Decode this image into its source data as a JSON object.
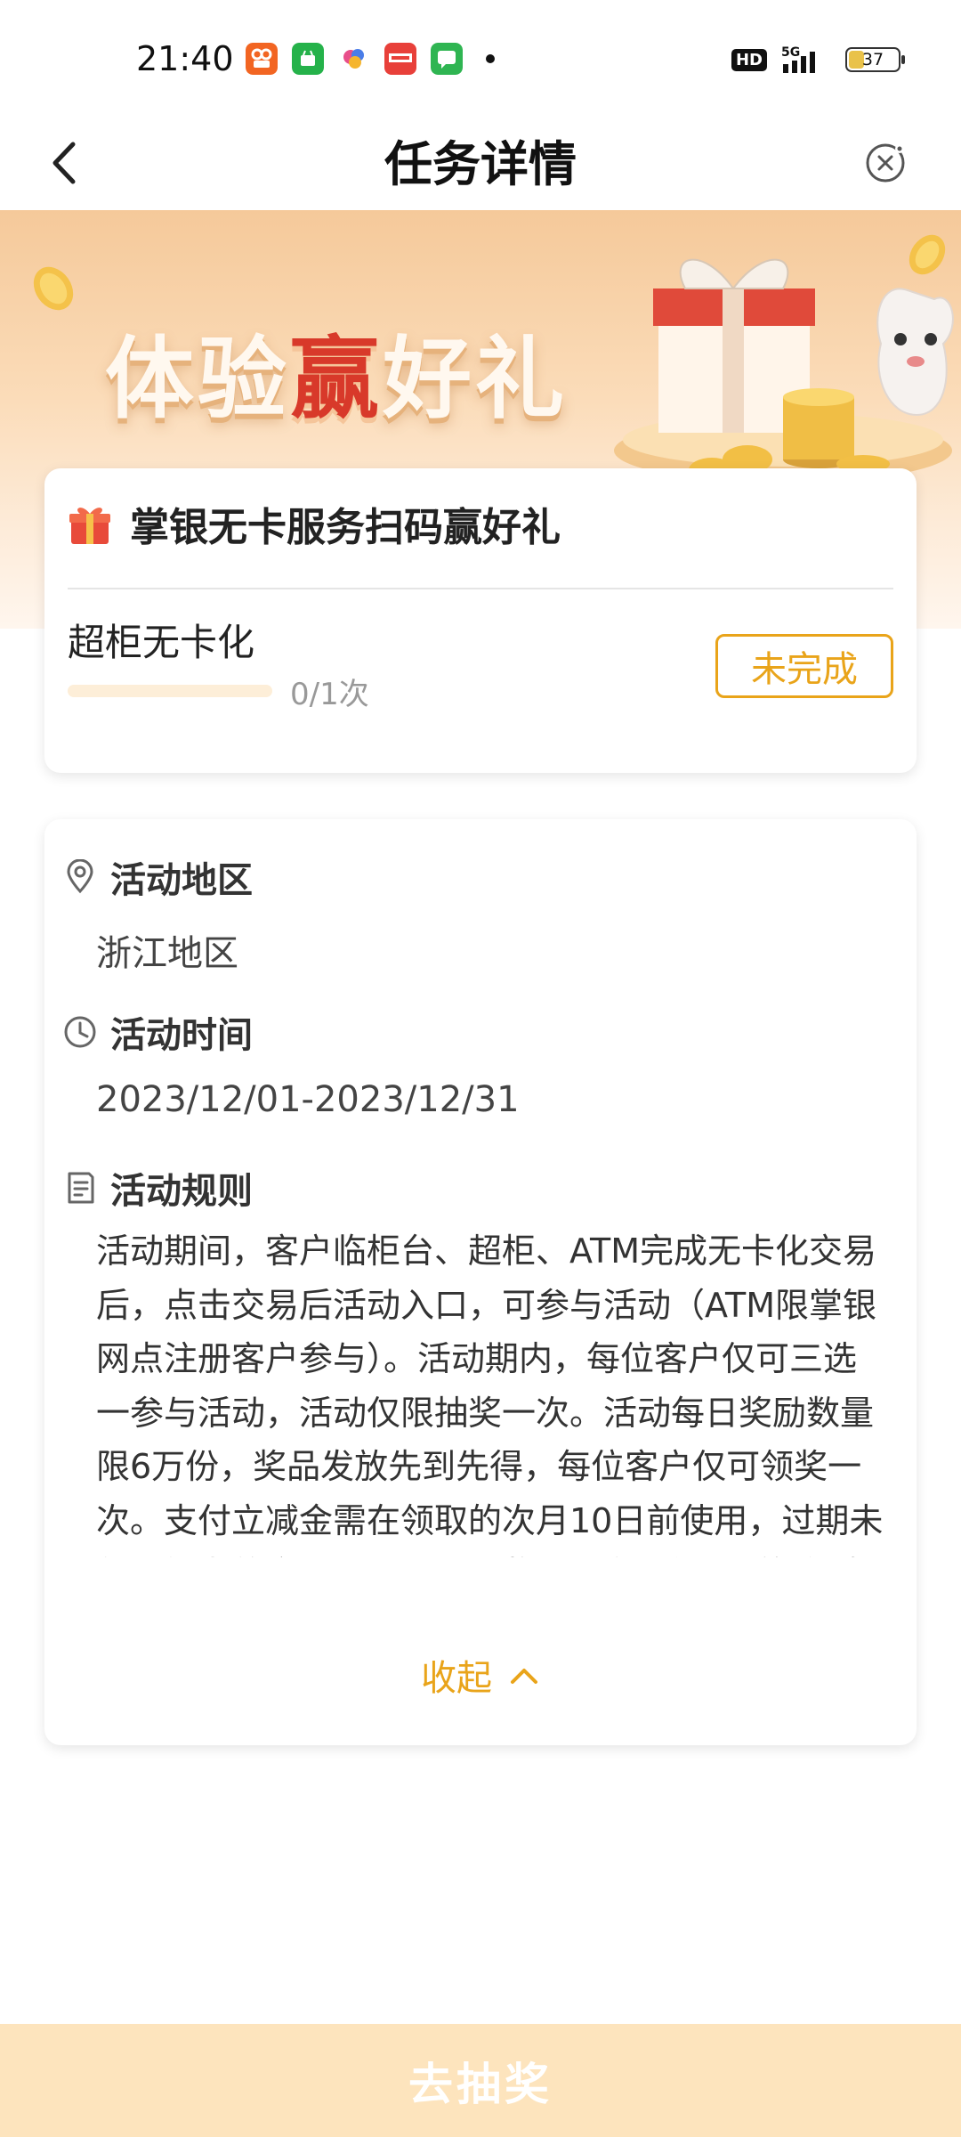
{
  "status_bar": {
    "time": "21:40",
    "network": "5G",
    "battery": "37",
    "battery_level": 0.37,
    "app_icons": [
      "app-orange-icon",
      "app-green-icon",
      "app-colorful-icon",
      "toutiao-icon",
      "message-green-icon"
    ]
  },
  "nav": {
    "title": "任务详情",
    "back_icon": "chevron-left-icon",
    "close_icon": "close-circle-icon"
  },
  "banner": {
    "title_part1": "体验",
    "title_highlight": "赢",
    "title_part2": "好礼"
  },
  "task_card": {
    "title": "掌银无卡服务扫码赢好礼",
    "task_name": "超柜无卡化",
    "progress_text": "0/1次",
    "progress_fraction": 0,
    "status_label": "未完成"
  },
  "info_card": {
    "region_title": "活动地区",
    "region_value": "浙江地区",
    "time_title": "活动时间",
    "time_value": "2023/12/01-2023/12/31",
    "rules_title": "活动规则",
    "rules_text": "活动期间，客户临柜台、超柜、ATM完成无卡化交易后，点击交易后活动入口，可参与活动（ATM限掌银网点注册客户参与）。活动期内，每位客户仅可三选一参与活动，活动仅限抽奖一次。活动每日奖励数量限6万份，奖品发放先到先得，每位客户仅可领奖一次。支付立减金需在领取的次月10日前使用，过期未使用视为放弃，不予退回，奖品可在掌银“我的-礼券-优惠券”中",
    "collapse_label": "收起"
  },
  "bottom": {
    "draw_label": "去抽奖"
  },
  "colors": {
    "accent": "#e9a41a",
    "banner_highlight": "#d8392a",
    "bottom_bar": "#fde4bd"
  }
}
